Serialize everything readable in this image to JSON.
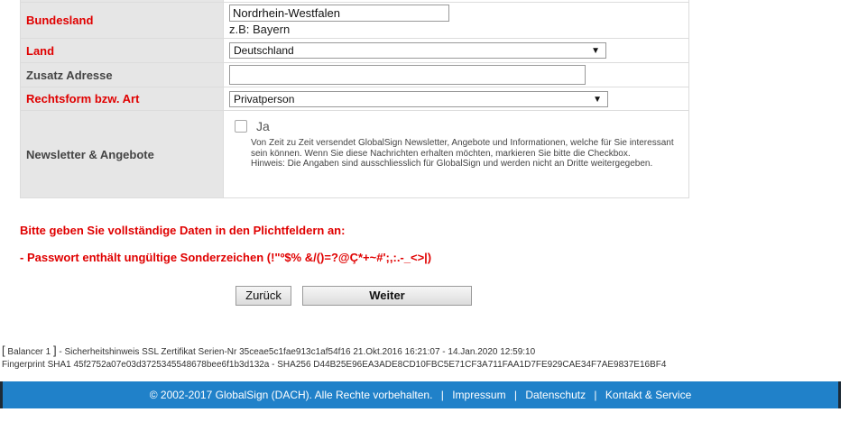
{
  "form": {
    "bundesland": {
      "label": "Bundesland",
      "value": "Nordrhein-Westfalen",
      "hint": "z.B: Bayern"
    },
    "land": {
      "label": "Land",
      "value": "Deutschland"
    },
    "zusatz": {
      "label": "Zusatz Adresse",
      "value": ""
    },
    "rechtsform": {
      "label": "Rechtsform bzw. Art",
      "value": "Privatperson"
    },
    "newsletter": {
      "label": "Newsletter & Angebote",
      "checkbox_label": "Ja",
      "checked": false,
      "text1": "Von Zeit zu Zeit versendet GlobalSign Newsletter, Angebote und Informationen, welche für Sie interessant sein können. Wenn Sie diese Nachrichten erhalten möchten, markieren Sie bitte die Checkbox.",
      "text2": "Hinweis: Die Angaben sind ausschliesslich für GlobalSign und werden nicht an Dritte weitergegeben."
    }
  },
  "errors": {
    "headline": "Bitte geben Sie vollständige Daten in den Plichtfeldern an:",
    "item1": "- Passwort enthält ungültige Sonderzeichen (!\"º$% &/()=?@Ç*+~#';,:.-_<>|)"
  },
  "buttons": {
    "back": "Zurück",
    "next": "Weiter"
  },
  "meta": {
    "bracket_open": "[",
    "balancer": "Balancer 1",
    "bracket_close": "]",
    "line1": "- Sicherheitshinweis SSL Zertifikat Serien-Nr 35ceae5c1fae913c1af54f16 21.Okt.2016 16:21:07 - 14.Jan.2020 12:59:10",
    "line2": "Fingerprint SHA1 45f2752a07e03d3725345548678bee6f1b3d132a - SHA256 D44B25E96EA3ADE8CD10FBC5E71CF3A711FAA1D7FE929CAE34F7AE9837E16BF4"
  },
  "footer": {
    "copyright": "© 2002-2017 GlobalSign (DACH). Alle Rechte vorbehalten.",
    "separator": "|",
    "links": [
      "Impressum",
      "Datenschutz",
      "Kontakt & Service"
    ]
  },
  "colors": {
    "required_label": "#e00000",
    "footer_bg": "#2081c9",
    "label_bg": "#e6e6e6"
  }
}
